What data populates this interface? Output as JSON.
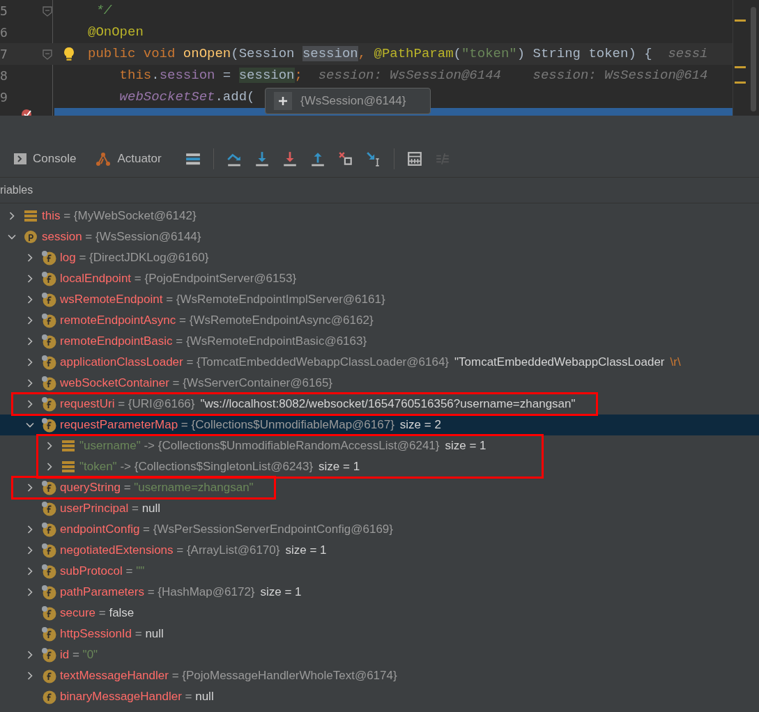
{
  "editor": {
    "lines": [
      {
        "number": "5",
        "fold": true,
        "bulb": false,
        "current": false,
        "tokens": [
          {
            "kind": "comment",
            "text": " */"
          }
        ]
      },
      {
        "number": "6",
        "fold": false,
        "bulb": false,
        "current": false,
        "tokens": [
          {
            "kind": "annotation",
            "text": "@OnOpen"
          }
        ]
      },
      {
        "number": "7",
        "fold": true,
        "bulb": true,
        "current": true,
        "tokens": [
          {
            "kind": "keyword",
            "text": "public void "
          },
          {
            "kind": "method",
            "text": "onOpen"
          },
          {
            "kind": "plain",
            "text": "(Session "
          },
          {
            "kind": "selected-word",
            "text": "session"
          },
          {
            "kind": "keyword",
            "text": ", "
          },
          {
            "kind": "annotation",
            "text": "@PathParam"
          },
          {
            "kind": "plain",
            "text": "("
          },
          {
            "kind": "string",
            "text": "\"token\""
          },
          {
            "kind": "plain",
            "text": ") String token) {"
          },
          {
            "kind": "hint",
            "text": "  sessi"
          }
        ]
      },
      {
        "number": "8",
        "fold": false,
        "bulb": false,
        "current": false,
        "tokens": [
          {
            "kind": "keyword",
            "text": "    this"
          },
          {
            "kind": "plain",
            "text": "."
          },
          {
            "kind": "field",
            "text": "session"
          },
          {
            "kind": "plain",
            "text": " = "
          },
          {
            "kind": "write-usage",
            "text": "session"
          },
          {
            "kind": "keyword",
            "text": ";"
          },
          {
            "kind": "hint",
            "text": "  session: WsSession@6144    session: WsSession@614"
          }
        ]
      },
      {
        "number": "9",
        "fold": false,
        "bulb": false,
        "current": false,
        "tokens": [
          {
            "kind": "static-field",
            "text": "    webSocketSet"
          },
          {
            "kind": "plain",
            "text": ".add("
          }
        ]
      }
    ],
    "execution_line": {
      "breakpoint": true
    },
    "tooltip": {
      "text": "{WsSession@6144}"
    }
  },
  "toolbar": {
    "tabs": [
      {
        "label": "Console"
      },
      {
        "label": "Actuator"
      }
    ],
    "buttons": [
      {
        "kind": "layout",
        "disabled": false
      },
      {
        "kind": "step-over",
        "disabled": false
      },
      {
        "kind": "step-into",
        "disabled": false
      },
      {
        "kind": "force-step-into",
        "disabled": false
      },
      {
        "kind": "step-out",
        "disabled": false
      },
      {
        "kind": "drop-frame",
        "disabled": false
      },
      {
        "kind": "run-to-cursor",
        "disabled": false
      },
      {
        "kind": "evaluate",
        "disabled": false
      },
      {
        "kind": "trace",
        "disabled": true
      }
    ]
  },
  "variables": {
    "title": "riables",
    "rows": [
      {
        "kind": "object",
        "name": "this",
        "separator": "=",
        "expanded": false,
        "selected": false,
        "boxed": false,
        "value": [
          {
            "kind": "ref",
            "text": "{MyWebSocket@6142}"
          }
        ]
      },
      {
        "kind": "param",
        "name": "session",
        "separator": "=",
        "expanded": true,
        "selected": false,
        "boxed": false,
        "value": [
          {
            "kind": "ref",
            "text": "{WsSession@6144}"
          }
        ],
        "children": [
          {
            "kind": "field",
            "name": "log",
            "final": true,
            "separator": "=",
            "expanded": false,
            "selected": false,
            "boxed": false,
            "value": [
              {
                "kind": "ref",
                "text": "{DirectJDKLog@6160}"
              }
            ]
          },
          {
            "kind": "field",
            "name": "localEndpoint",
            "final": true,
            "separator": "=",
            "expanded": false,
            "selected": false,
            "boxed": false,
            "value": [
              {
                "kind": "ref",
                "text": "{PojoEndpointServer@6153}"
              }
            ]
          },
          {
            "kind": "field",
            "name": "wsRemoteEndpoint",
            "final": true,
            "separator": "=",
            "expanded": false,
            "selected": false,
            "boxed": false,
            "value": [
              {
                "kind": "ref",
                "text": "{WsRemoteEndpointImplServer@6161}"
              }
            ]
          },
          {
            "kind": "field",
            "name": "remoteEndpointAsync",
            "final": true,
            "separator": "=",
            "expanded": false,
            "selected": false,
            "boxed": false,
            "value": [
              {
                "kind": "ref",
                "text": "{WsRemoteEndpointAsync@6162}"
              }
            ]
          },
          {
            "kind": "field",
            "name": "remoteEndpointBasic",
            "final": true,
            "separator": "=",
            "expanded": false,
            "selected": false,
            "boxed": false,
            "value": [
              {
                "kind": "ref",
                "text": "{WsRemoteEndpointBasic@6163}"
              }
            ]
          },
          {
            "kind": "field",
            "name": "applicationClassLoader",
            "final": true,
            "separator": "=",
            "expanded": false,
            "selected": false,
            "boxed": false,
            "value": [
              {
                "kind": "ref",
                "text": "{TomcatEmbeddedWebappClassLoader@6164}"
              },
              {
                "kind": "text",
                "text": "\"TomcatEmbeddedWebappClassLoader"
              },
              {
                "kind": "escape",
                "text": "\\r\\"
              }
            ]
          },
          {
            "kind": "field",
            "name": "webSocketContainer",
            "final": true,
            "separator": "=",
            "expanded": false,
            "selected": false,
            "boxed": false,
            "value": [
              {
                "kind": "ref",
                "text": "{WsServerContainer@6165}"
              }
            ]
          },
          {
            "kind": "field",
            "name": "requestUri",
            "final": true,
            "separator": "=",
            "expanded": false,
            "selected": false,
            "boxed": true,
            "value": [
              {
                "kind": "ref",
                "text": "{URI@6166}"
              },
              {
                "kind": "text",
                "text": "\"ws://localhost:8082/websocket/1654760516356?username=zhangsan\""
              }
            ]
          },
          {
            "kind": "field",
            "name": "requestParameterMap",
            "final": true,
            "separator": "=",
            "expanded": true,
            "selected": true,
            "boxed": false,
            "children_boxed": true,
            "value": [
              {
                "kind": "ref",
                "text": "{Collections$UnmodifiableMap@6167}"
              },
              {
                "kind": "text",
                "text": "size = 2"
              }
            ],
            "children": [
              {
                "kind": "entry",
                "name": "\"username\"",
                "separator": "->",
                "expanded": false,
                "selected": false,
                "boxed": false,
                "value": [
                  {
                    "kind": "ref",
                    "text": "{Collections$UnmodifiableRandomAccessList@6241}"
                  },
                  {
                    "kind": "text",
                    "text": "size = 1"
                  }
                ]
              },
              {
                "kind": "entry",
                "name": "\"token\"",
                "separator": "->",
                "expanded": false,
                "selected": false,
                "boxed": false,
                "value": [
                  {
                    "kind": "ref",
                    "text": "{Collections$SingletonList@6243}"
                  },
                  {
                    "kind": "text",
                    "text": "size = 1"
                  }
                ]
              }
            ]
          },
          {
            "kind": "field",
            "name": "queryString",
            "final": true,
            "separator": "=",
            "expanded": false,
            "selected": false,
            "boxed": true,
            "value": [
              {
                "kind": "string",
                "text": "\"username=zhangsan\""
              }
            ]
          },
          {
            "kind": "field",
            "name": "userPrincipal",
            "final": true,
            "separator": "=",
            "selected": false,
            "boxed": false,
            "value": [
              {
                "kind": "text",
                "text": "null"
              }
            ]
          },
          {
            "kind": "field",
            "name": "endpointConfig",
            "final": true,
            "separator": "=",
            "expanded": false,
            "selected": false,
            "boxed": false,
            "value": [
              {
                "kind": "ref",
                "text": "{WsPerSessionServerEndpointConfig@6169}"
              }
            ]
          },
          {
            "kind": "field",
            "name": "negotiatedExtensions",
            "final": true,
            "separator": "=",
            "expanded": false,
            "selected": false,
            "boxed": false,
            "value": [
              {
                "kind": "ref",
                "text": "{ArrayList@6170}"
              },
              {
                "kind": "text",
                "text": "size = 1"
              }
            ]
          },
          {
            "kind": "field",
            "name": "subProtocol",
            "final": true,
            "separator": "=",
            "expanded": false,
            "selected": false,
            "boxed": false,
            "value": [
              {
                "kind": "string",
                "text": "\"\""
              }
            ]
          },
          {
            "kind": "field",
            "name": "pathParameters",
            "final": true,
            "separator": "=",
            "expanded": false,
            "selected": false,
            "boxed": false,
            "value": [
              {
                "kind": "ref",
                "text": "{HashMap@6172}"
              },
              {
                "kind": "text",
                "text": "size = 1"
              }
            ]
          },
          {
            "kind": "field",
            "name": "secure",
            "final": true,
            "separator": "=",
            "selected": false,
            "boxed": false,
            "value": [
              {
                "kind": "text",
                "text": "false"
              }
            ]
          },
          {
            "kind": "field",
            "name": "httpSessionId",
            "final": true,
            "separator": "=",
            "selected": false,
            "boxed": false,
            "value": [
              {
                "kind": "text",
                "text": "null"
              }
            ]
          },
          {
            "kind": "field",
            "name": "id",
            "final": true,
            "separator": "=",
            "expanded": false,
            "selected": false,
            "boxed": false,
            "value": [
              {
                "kind": "string",
                "text": "\"0\""
              }
            ]
          },
          {
            "kind": "field",
            "name": "textMessageHandler",
            "final": false,
            "separator": "=",
            "expanded": false,
            "selected": false,
            "boxed": false,
            "value": [
              {
                "kind": "ref",
                "text": "{PojoMessageHandlerWholeText@6174}"
              }
            ]
          },
          {
            "kind": "field",
            "name": "binaryMessageHandler",
            "final": false,
            "separator": "=",
            "selected": false,
            "boxed": false,
            "value": [
              {
                "kind": "text",
                "text": "null"
              }
            ]
          }
        ]
      }
    ]
  }
}
